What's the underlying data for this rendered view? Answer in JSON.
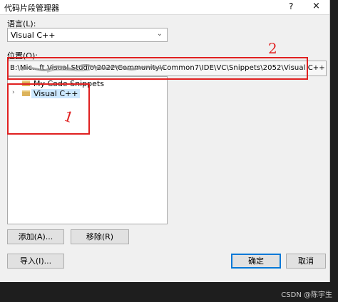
{
  "window": {
    "title": "代码片段管理器",
    "help_label": "?",
    "close_label": "×"
  },
  "language": {
    "label": "语言(L):",
    "selected": "Visual C++"
  },
  "location": {
    "label": "位置(O):",
    "value": "B:\\Mic…ft Visual Studio\\2022\\Community\\Common7\\IDE\\VC\\Snippets\\2052\\Visual C++"
  },
  "tree": {
    "items": [
      {
        "label": "My Code Snippets",
        "expander": ""
      },
      {
        "label": "Visual C++",
        "expander": "›"
      }
    ]
  },
  "buttons": {
    "add": "添加(A)...",
    "remove": "移除(R)",
    "import": "导入(I)...",
    "ok": "确定",
    "cancel": "取消"
  },
  "annotations": {
    "mark_1": "1",
    "mark_2": "2",
    "color": "#e02020"
  },
  "watermark": "CSDN @陈宇生"
}
